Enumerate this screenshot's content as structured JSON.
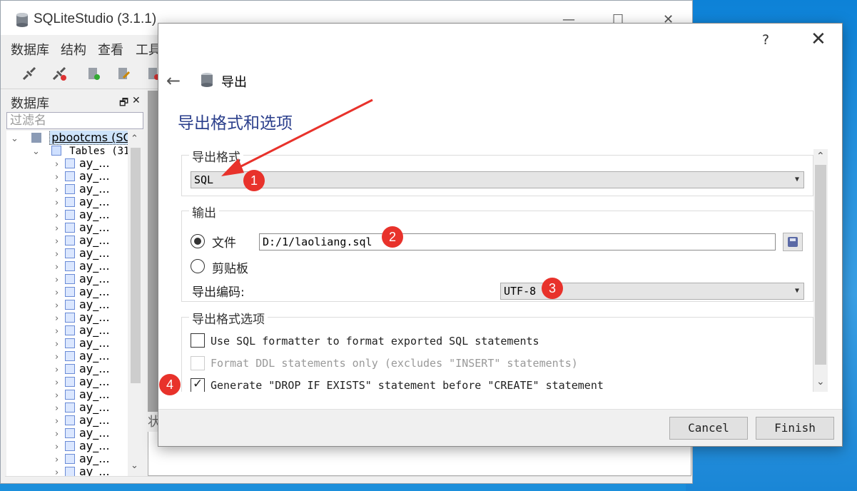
{
  "app": {
    "title": "SQLiteStudio (3.1.1)",
    "window_controls": {
      "minimize": "—",
      "maximize": "☐",
      "close": "✕"
    },
    "menu": [
      "数据库",
      "结构",
      "查看",
      "工具"
    ]
  },
  "db_panel": {
    "title": "数据库",
    "float_btn": "🗗",
    "close_btn": "✕",
    "filter_placeholder": "过滤名",
    "database_label": "pbootcms (SQL",
    "tables_label": "Tables (31",
    "table_item_label": "ay_...",
    "table_rows": 25
  },
  "status_tab_label": "状",
  "dialog": {
    "help": "?",
    "close": "✕",
    "back": "←",
    "title": "导出",
    "heading": "导出格式和选项",
    "format_group": {
      "title": "导出格式",
      "selected": "SQL"
    },
    "output_group": {
      "title": "输出",
      "file_label": "文件",
      "file_path": "D:/1/laoliang.sql",
      "clipboard_label": "剪贴板",
      "encoding_label": "导出编码:",
      "encoding_value": "UTF-8"
    },
    "options_group": {
      "title": "导出格式选项",
      "opt1": "Use SQL formatter to format exported SQL statements",
      "opt2": "Format DDL statements only (excludes \"INSERT\" statements)",
      "opt3": "Generate \"DROP IF EXISTS\" statement before \"CREATE\" statement"
    },
    "cancel": "Cancel",
    "finish": "Finish"
  },
  "annotations": [
    "1",
    "2",
    "3",
    "4"
  ],
  "colors": {
    "heading": "#2b3f8c",
    "badge": "#e8322b",
    "desktop": "#1c8fdb"
  }
}
